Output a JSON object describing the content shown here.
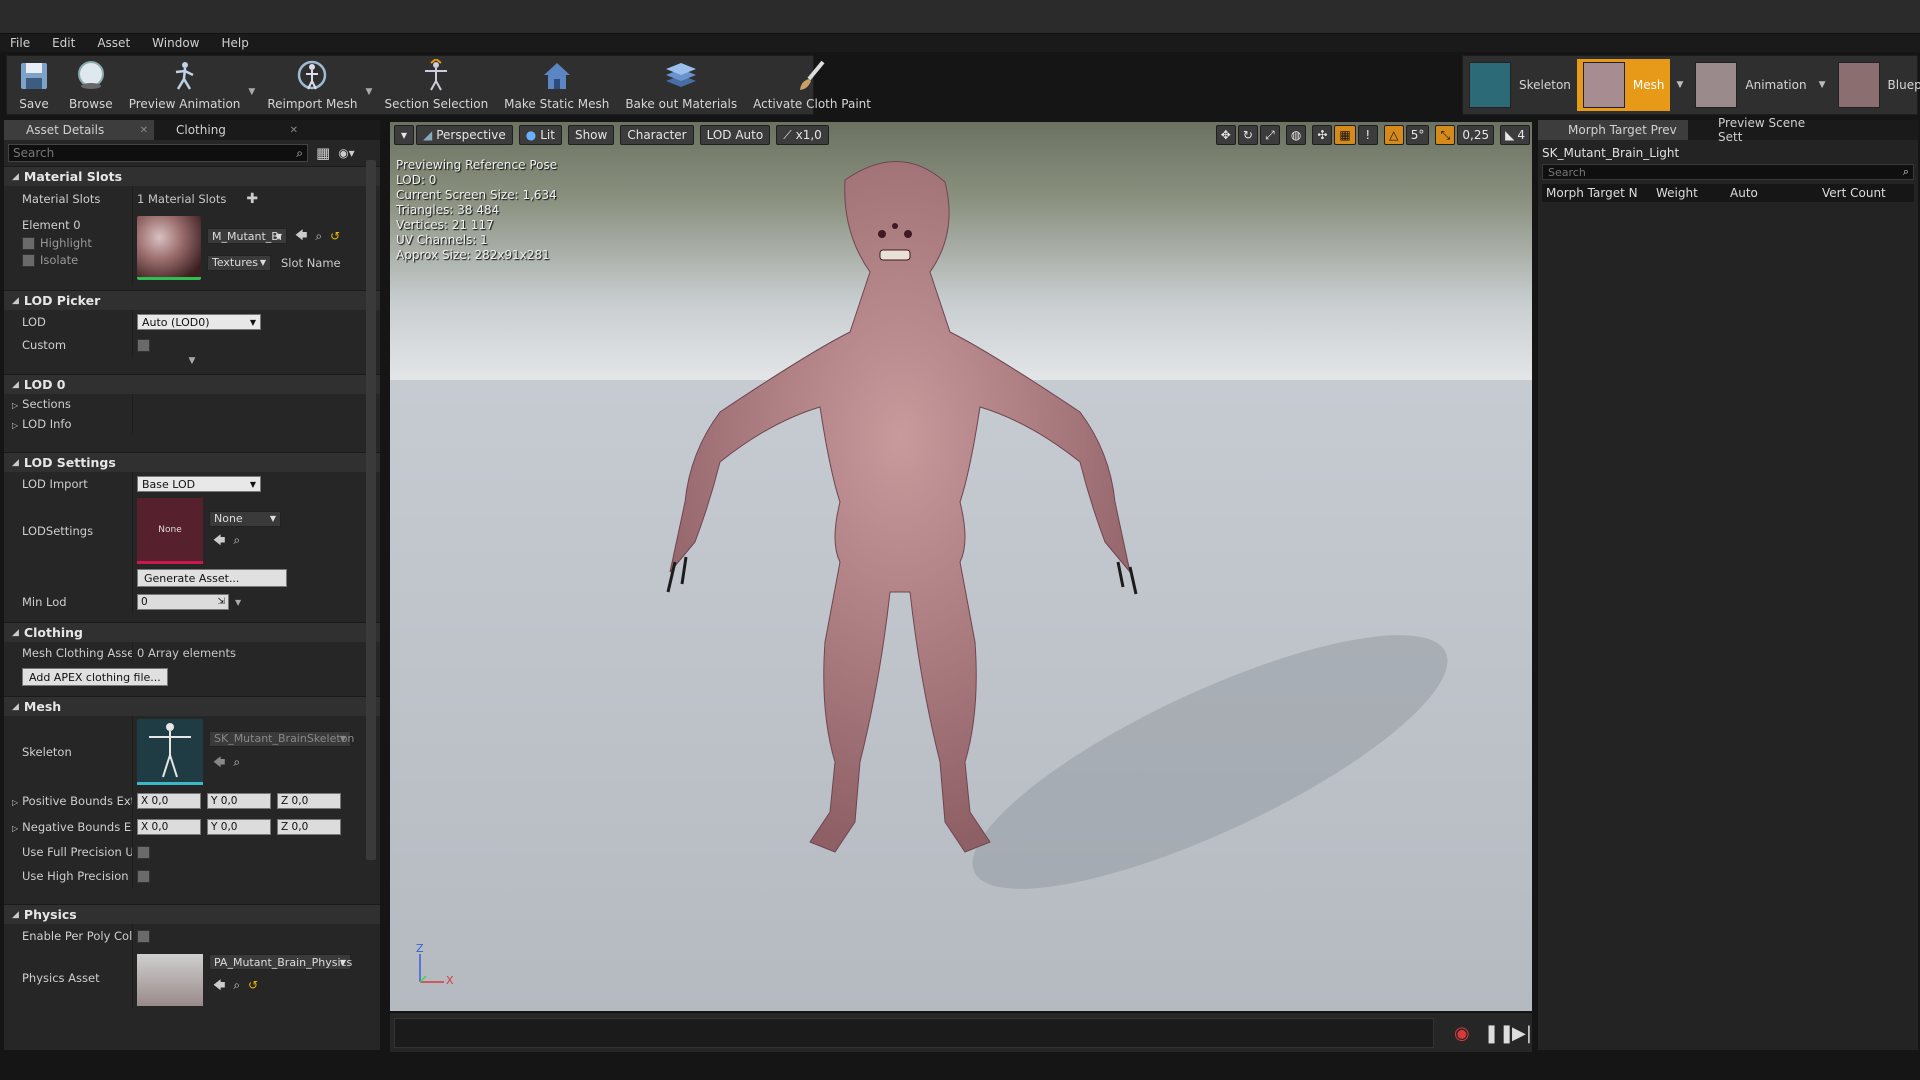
{
  "menu": [
    "File",
    "Edit",
    "Asset",
    "Window",
    "Help"
  ],
  "toolbar": {
    "buttons": [
      "Save",
      "Browse",
      "Preview Animation",
      "Reimport Mesh",
      "Section Selection",
      "Make Static Mesh",
      "Bake out Materials",
      "Activate Cloth Paint"
    ]
  },
  "modes": {
    "skeleton": "Skeleton",
    "mesh": "Mesh",
    "animation": "Animation",
    "blueprint": "Blueprint",
    "active_color": "#e69a18"
  },
  "left": {
    "tabs": [
      "Asset Details",
      "Clothing"
    ],
    "search_placeholder": "Search",
    "material_slots": {
      "header": "Material Slots",
      "label": "Material Slots",
      "value": "1 Material Slots",
      "element": "Element 0",
      "highlight": "Highlight",
      "isolate": "Isolate",
      "material": "M_Mutant_Bı",
      "textures": "Textures",
      "slot_name": "Slot Name"
    },
    "lod_picker": {
      "header": "LOD Picker",
      "lod_label": "LOD",
      "lod_value": "Auto (LOD0)",
      "custom_label": "Custom"
    },
    "lod0": {
      "header": "LOD 0",
      "sections": "Sections",
      "lod_info": "LOD Info"
    },
    "lod_settings": {
      "header": "LOD Settings",
      "lod_import_label": "LOD Import",
      "lod_import_value": "Base LOD",
      "lodsettings_label": "LODSettings",
      "thumb_text": "None",
      "combo_value": "None",
      "generate_button": "Generate Asset...",
      "min_lod_label": "Min Lod",
      "min_lod_value": "0"
    },
    "clothing": {
      "header": "Clothing",
      "assets_label": "Mesh Clothing Assets",
      "assets_value": "0 Array elements",
      "add_button": "Add APEX clothing file..."
    },
    "mesh": {
      "header": "Mesh",
      "skeleton_label": "Skeleton",
      "skeleton_value": "SK_Mutant_BrainSkeleton",
      "pos_bounds_label": "Positive Bounds Exte",
      "neg_bounds_label": "Negative Bounds Exte",
      "axis_x": "X",
      "axis_y": "Y",
      "axis_z": "Z",
      "bounds_value": "0,0",
      "full_precision_label": "Use Full Precision UV",
      "high_precision_label": "Use High Precision Ta"
    },
    "physics": {
      "header": "Physics",
      "per_poly_label": "Enable Per Poly Collis",
      "asset_label": "Physics Asset",
      "asset_value": "PA_Mutant_Brain_Physics"
    }
  },
  "viewport": {
    "menu_arrow": "▾",
    "perspective": "Perspective",
    "lit": "Lit",
    "show": "Show",
    "character": "Character",
    "lod_auto": "LOD Auto",
    "speed": "x1,0",
    "snap_angle": "5°",
    "scale_snap": "0,25",
    "cam_speed": "4",
    "stats": [
      "Previewing Reference Pose",
      "LOD: 0",
      "Current Screen Size: 1,634",
      "Triangles: 38 484",
      "Vertices: 21 117",
      "UV Channels: 1",
      "Approx Size: 282x91x281"
    ],
    "axis_z": "Z",
    "axis_x": "X"
  },
  "right": {
    "tabs": [
      "Morph Target Prev",
      "Preview Scene Sett"
    ],
    "title": "SK_Mutant_Brain_Light",
    "search_placeholder": "Search",
    "columns": [
      "Morph Target N",
      "Weight",
      "Auto",
      "Vert Count"
    ]
  }
}
